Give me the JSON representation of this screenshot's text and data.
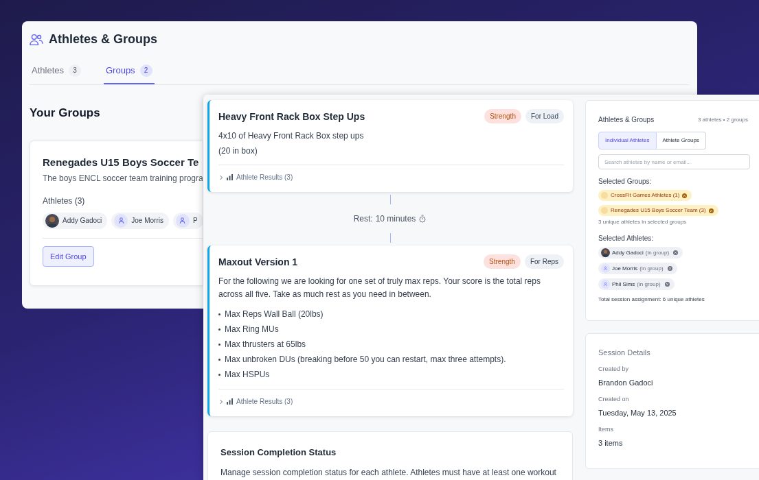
{
  "back_window": {
    "title": "Athletes & Groups",
    "tabs": [
      {
        "label": "Athletes",
        "count": "3",
        "selected": false
      },
      {
        "label": "Groups",
        "count": "2",
        "selected": true
      }
    ],
    "section_title": "Your Groups",
    "group_card": {
      "name": "Renegades U15 Boys Soccer Te",
      "description": "The boys ENCL soccer team training progra",
      "athletes_label": "Athletes (3)",
      "athletes": [
        {
          "name": "Addy Gadoci",
          "kind": "photo"
        },
        {
          "name": "Joe Morris",
          "kind": "icon"
        },
        {
          "name": "P",
          "kind": "icon"
        }
      ],
      "button": "Edit Group"
    }
  },
  "session": {
    "items": [
      {
        "kind": "workout",
        "title": "Heavy Front Rack Box Step Ups",
        "tags": [
          {
            "label": "Strength",
            "kind": "category"
          },
          {
            "label": "For Load",
            "kind": "scoring"
          }
        ],
        "lines": [
          "4x10 of Heavy Front Rack Box step ups",
          "(20 in box)"
        ],
        "results": "Athlete Results (3)"
      },
      {
        "kind": "rest",
        "label": "Rest:",
        "value": "10 minutes"
      },
      {
        "kind": "workout",
        "title": "Maxout Version 1",
        "tags": [
          {
            "label": "Strength",
            "kind": "category"
          },
          {
            "label": "For Reps",
            "kind": "scoring"
          }
        ],
        "lines": [
          "For the following we are looking for one set of truly max reps. Your score is the total reps across all five. Take as much rest as you need in between."
        ],
        "bullets": [
          "Max Reps Wall Ball (20lbs)",
          "Max Ring MUs",
          "Max thrusters at 65lbs",
          "Max unbroken DUs (breaking before 50 you can restart, max three attempts).",
          "Max HSPUs"
        ],
        "results": "Athlete Results (3)"
      }
    ],
    "completion": {
      "title": "Session Completion Status",
      "text": "Manage session completion status for each athlete. Athletes must have at least one workout"
    }
  },
  "assign": {
    "title": "Athletes & Groups",
    "summary": "3 athletes • 2 groups",
    "toggle": [
      {
        "label": "Individual Athletes",
        "selected": true
      },
      {
        "label": "Athlete Groups",
        "selected": false
      }
    ],
    "search": {
      "placeholder": "Search athletes by name or email..."
    },
    "groups_label": "Selected Groups:",
    "groups": [
      "CrossFit Games Athletes (1)",
      "Renegades U15 Boys Soccer Team (3)"
    ],
    "groups_note": "3 unique athletes in selected groups",
    "athletes_label": "Selected Athletes:",
    "athletes": [
      {
        "name": "Addy Gadoci",
        "note": "(in group)",
        "kind": "photo"
      },
      {
        "name": "Joe Morris",
        "note": "(in group)",
        "kind": "icon"
      },
      {
        "name": "Phil Sims",
        "note": "(in group)",
        "kind": "icon"
      }
    ],
    "total": "Total session assignment: 6 unique athletes"
  },
  "details": {
    "title": "Session Details",
    "fields": [
      {
        "label": "Created by",
        "value": "Brandon Gadoci"
      },
      {
        "label": "Created on",
        "value": "Tuesday, May 13, 2025"
      },
      {
        "label": "Items",
        "value": "3 items"
      }
    ]
  }
}
